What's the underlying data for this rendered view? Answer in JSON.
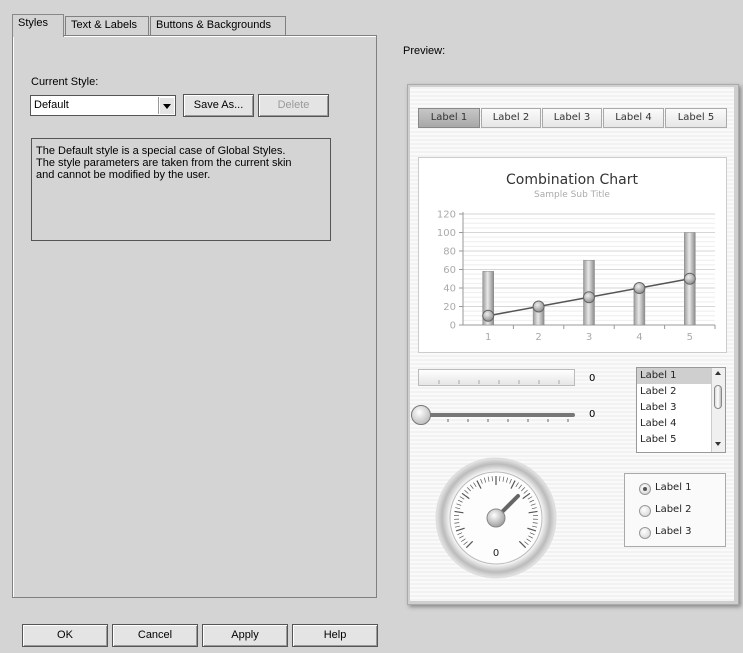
{
  "tabs": [
    {
      "label": "Styles",
      "active": true
    },
    {
      "label": "Text & Labels",
      "active": false
    },
    {
      "label": "Buttons & Backgrounds",
      "active": false
    }
  ],
  "styles_panel": {
    "current_style_label": "Current Style:",
    "current_style_value": "Default",
    "save_as_label": "Save As...",
    "delete_label": "Delete",
    "description": "The Default style is a special case of Global Styles.\nThe style parameters are taken from the current skin\nand cannot be modified by the user."
  },
  "footer": {
    "ok_label": "OK",
    "cancel_label": "Cancel",
    "apply_label": "Apply",
    "help_label": "Help"
  },
  "preview": {
    "label": "Preview:",
    "tabs": [
      "Label 1",
      "Label 2",
      "Label 3",
      "Label 4",
      "Label 5"
    ],
    "selected_tab": 0,
    "progress_value": "0",
    "progress_fraction": 0,
    "slider_value": "0",
    "slider_fraction": 0,
    "listbox_items": [
      "Label 1",
      "Label 2",
      "Label 3",
      "Label 4",
      "Label 5"
    ],
    "listbox_selected": 0,
    "gauge_value": "0",
    "radio_items": [
      "Label 1",
      "Label 2",
      "Label 3"
    ],
    "radio_selected": 0
  },
  "chart_data": {
    "type": "bar",
    "title": "Combination Chart",
    "subtitle": "Sample Sub Title",
    "categories": [
      "1",
      "2",
      "3",
      "4",
      "5"
    ],
    "series": [
      {
        "type": "bar",
        "values": [
          58,
          22,
          70,
          42,
          100
        ]
      },
      {
        "type": "line",
        "values": [
          10,
          20,
          30,
          40,
          50
        ]
      }
    ],
    "ylim": [
      0,
      120
    ],
    "yticks": [
      "0",
      "20",
      "40",
      "60",
      "80",
      "100",
      "120"
    ],
    "grid": true
  }
}
